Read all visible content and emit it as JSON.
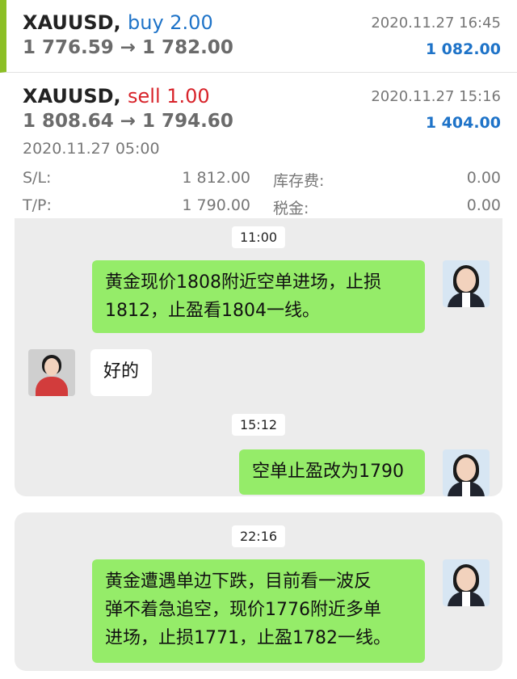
{
  "trades": [
    {
      "symbol": "XAUUSD,",
      "side": "buy 2.00",
      "prices": "1 776.59 → 1 782.00",
      "close_time": "2020.11.27 16:45",
      "profit": "1 082.00"
    },
    {
      "symbol": "XAUUSD,",
      "side": "sell 1.00",
      "prices": "1 808.64 → 1 794.60",
      "close_time": "2020.11.27 15:16",
      "profit": "1 404.00",
      "open_time": "2020.11.27 05:00",
      "sl_label": "S/L:",
      "sl_value": "1 812.00",
      "swap_label": "库存费:",
      "swap_value": "0.00",
      "tp_label": "T/P:",
      "tp_value": "1 790.00",
      "tax_label": "税金:",
      "tax_value": "0.00"
    }
  ],
  "chat1": {
    "time1": "11:00",
    "msg1": "黄金现价1808附近空单进场，止损\n1812，止盈看1804一线。",
    "reply": "好的",
    "time2": "15:12",
    "msg2": "空单止盈改为1790"
  },
  "chat2": {
    "time": "22:16",
    "msg": "黄金遭遇单边下跌，目前看一波反\n弹不着急追空，现价1776附近多单\n进场，止损1771，止盈1782一线。"
  },
  "colors": {
    "bubble_green": "#95ec69",
    "buy_blue": "#1e73c8",
    "sell_red": "#d8232a",
    "accent_green": "#8cbf26"
  }
}
